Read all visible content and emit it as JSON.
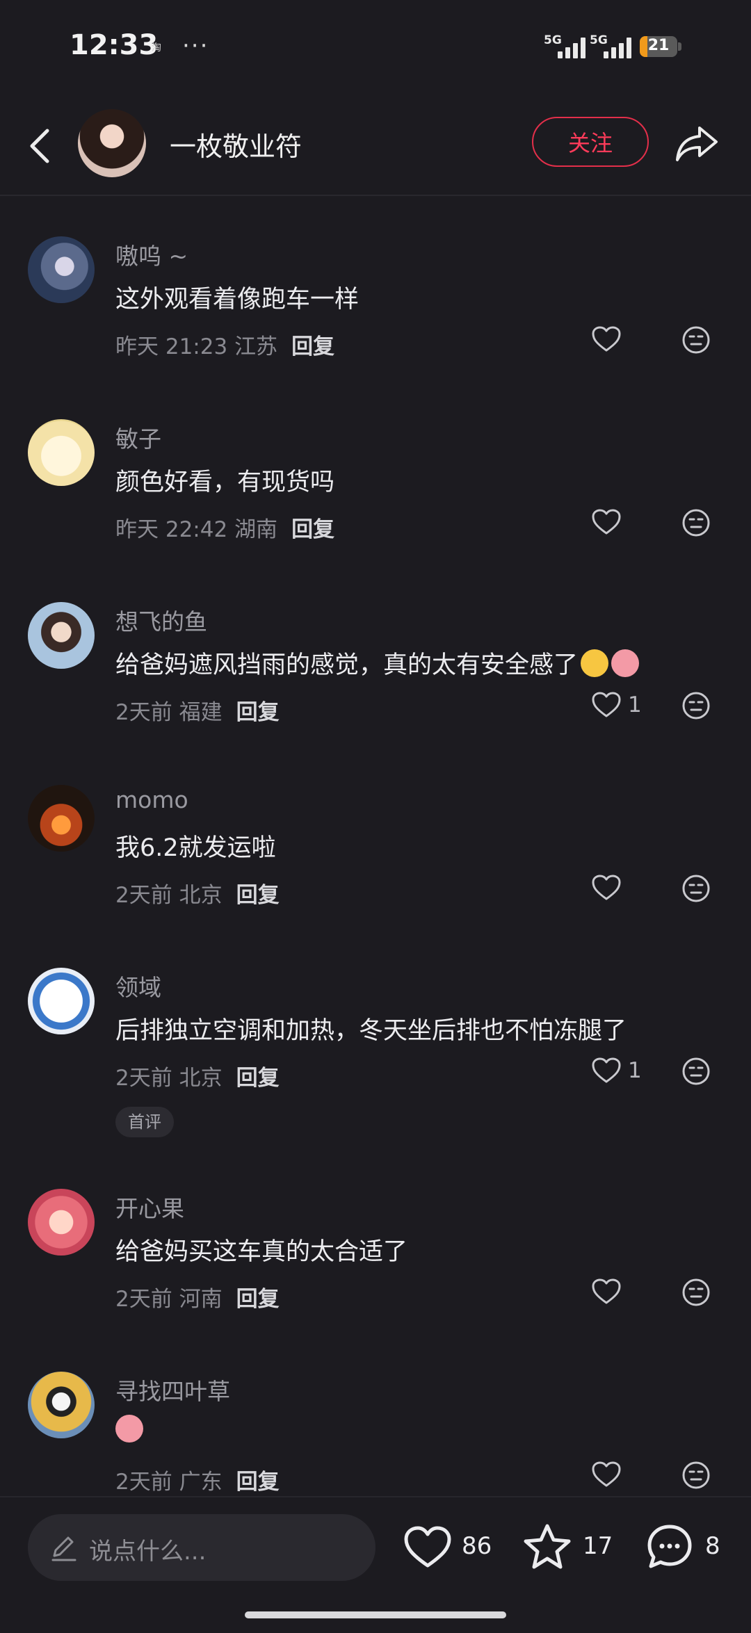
{
  "status_bar": {
    "time": "12:33",
    "app_badge": "淘",
    "more": "···",
    "signal1_label": "5G",
    "signal2_label": "5G",
    "battery_level": "21",
    "battery_fraction": 0.21
  },
  "header": {
    "user_name": "一枚敬业符",
    "follow_label": "关注"
  },
  "comments": [
    {
      "name": "嗷呜 ~",
      "text": "这外观看着像跑车一样",
      "time": "昨天 21:23",
      "location": "江苏",
      "reply": "回复",
      "likes": ""
    },
    {
      "name": "敏子",
      "text": "颜色好看，有现货吗",
      "time": "昨天 22:42",
      "location": "湖南",
      "reply": "回复",
      "likes": ""
    },
    {
      "name": "想飞的鱼",
      "text": "给爸妈遮风挡雨的感觉，真的太有安全感了",
      "time": "2天前",
      "location": "福建",
      "reply": "回复",
      "likes": "1"
    },
    {
      "name": "momo",
      "text": "我6.2就发运啦",
      "time": "2天前",
      "location": "北京",
      "reply": "回复",
      "likes": ""
    },
    {
      "name": "领域",
      "text": "后排独立空调和加热，冬天坐后排也不怕冻腿了",
      "time": "2天前",
      "location": "北京",
      "reply": "回复",
      "likes": "1",
      "badge": "首评"
    },
    {
      "name": "开心果",
      "text": "给爸妈买这车真的太合适了",
      "time": "2天前",
      "location": "河南",
      "reply": "回复",
      "likes": ""
    },
    {
      "name": "寻找四叶草",
      "text": "",
      "time": "2天前",
      "location": "广东",
      "reply": "回复",
      "likes": ""
    }
  ],
  "bottom_bar": {
    "input_placeholder": "说点什么...",
    "likes": "86",
    "favorites": "17",
    "comments": "8"
  }
}
